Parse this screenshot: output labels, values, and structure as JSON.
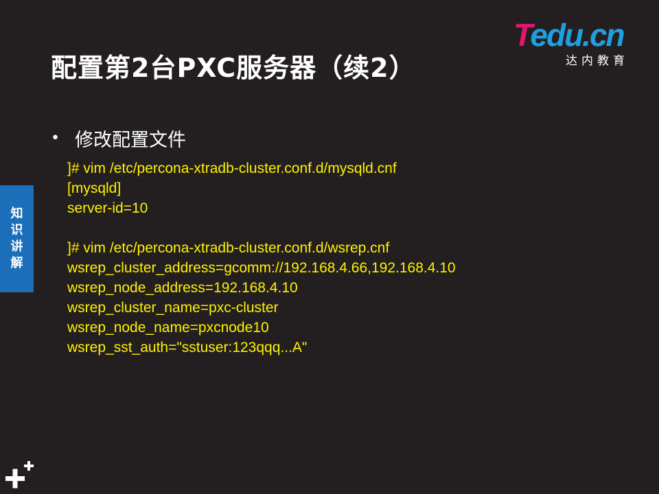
{
  "slide": {
    "title": "配置第2台PXC服务器（续2）",
    "bullet": "修改配置文件"
  },
  "logo": {
    "brand_t": "T",
    "brand_rest": "edu.cn",
    "subtitle": "达内教育"
  },
  "side_tab": {
    "chars": [
      "知",
      "识",
      "讲",
      "解"
    ]
  },
  "code_lines": [
    "]# vim /etc/percona-xtradb-cluster.conf.d/mysqld.cnf",
    "[mysqld]",
    "server-id=10",
    "",
    "]# vim /etc/percona-xtradb-cluster.conf.d/wsrep.cnf",
    "wsrep_cluster_address=gcomm://192.168.4.66,192.168.4.10",
    "wsrep_node_address=192.168.4.10",
    "wsrep_cluster_name=pxc-cluster",
    "wsrep_node_name=pxcnode10",
    "wsrep_sst_auth=\"sstuser:123qqq...A\""
  ],
  "colors": {
    "background": "#231f20",
    "code_text": "#fff200",
    "side_tab": "#1a6fb8",
    "logo_pink": "#e5166f",
    "logo_blue": "#1f9fe0"
  },
  "icons": {
    "corner": "plus-decoration-icon",
    "bullet": "bullet-dot-icon"
  }
}
